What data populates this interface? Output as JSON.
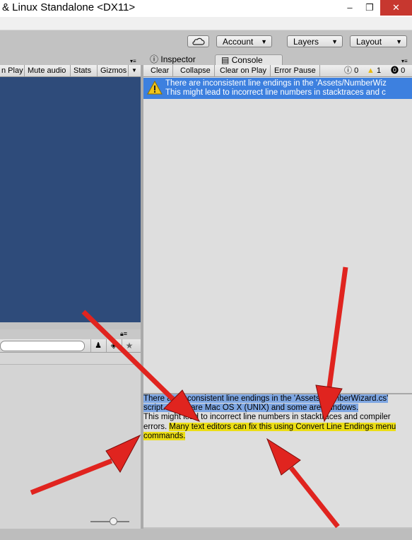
{
  "window": {
    "title": "& Linux Standalone <DX11>",
    "controls": {
      "minimize": "–",
      "restore": "❐",
      "close": "✕"
    }
  },
  "toolbar": {
    "cloud_icon": "cloud-icon",
    "account": "Account",
    "layers": "Layers",
    "layout": "Layout"
  },
  "tabs": {
    "inspector": "Inspector",
    "console": "Console"
  },
  "scene_toolbar": {
    "maximize_on_play": "n Play",
    "mute_audio": "Mute audio",
    "stats": "Stats",
    "gizmos": "Gizmos"
  },
  "console_toolbar": {
    "clear": "Clear",
    "collapse": "Collapse",
    "clear_on_play": "Clear on Play",
    "error_pause": "Error Pause",
    "info_count": "0",
    "warning_count": "1",
    "error_count": "0"
  },
  "log_entry": {
    "line1": "There are inconsistent line endings in the 'Assets/NumberWiz",
    "line2": "This might lead to incorrect line numbers in stacktraces and c"
  },
  "detail": {
    "part1": "There are inconsistent line endings in the 'Assets/NumberWizard.cs' script. Some are Mac OS X (UNIX) and some are Windows.",
    "part2": "This might lead to incorrect line numbers in stacktraces and compiler errors. ",
    "part3": "Many text editors can fix this using Convert Line Endings menu commands."
  },
  "colors": {
    "game_view": "#2e4b7a",
    "selected_row": "#3d80df",
    "highlight_yellow": "#ecde16",
    "arrow_red": "#e0241f"
  }
}
